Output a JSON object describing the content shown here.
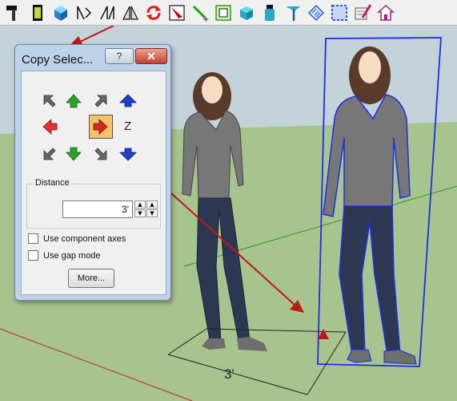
{
  "toolbar": {
    "icons": [
      "hammer-icon",
      "paint-bucket-icon",
      "cube-icon",
      "flip-x-icon",
      "flip-y-icon",
      "mirror-icon",
      "rotate-icon",
      "scale-icon",
      "move-icon",
      "select-frame-icon",
      "component-icon",
      "paint-icon",
      "pin-icon",
      "striped-box-icon",
      "dashed-box-icon",
      "paint-brush-icon",
      "house-icon"
    ]
  },
  "dialog": {
    "title": "Copy Selec...",
    "help_label": "?",
    "close_label": "✕",
    "z_label": "Z",
    "distance": {
      "legend": "Distance",
      "value": "3'"
    },
    "options": [
      {
        "label": "Use component axes",
        "checked": false
      },
      {
        "label": "Use gap mode",
        "checked": false
      }
    ],
    "more_label": "More..."
  },
  "scene": {
    "dimension_label": "3'"
  },
  "colors": {
    "sky": "#c4d3d9",
    "ground": "#a8c48e",
    "selection": "#1e2de8",
    "annotation_arrow": "#c01818",
    "dialog_frame": "#bcd3ea"
  }
}
